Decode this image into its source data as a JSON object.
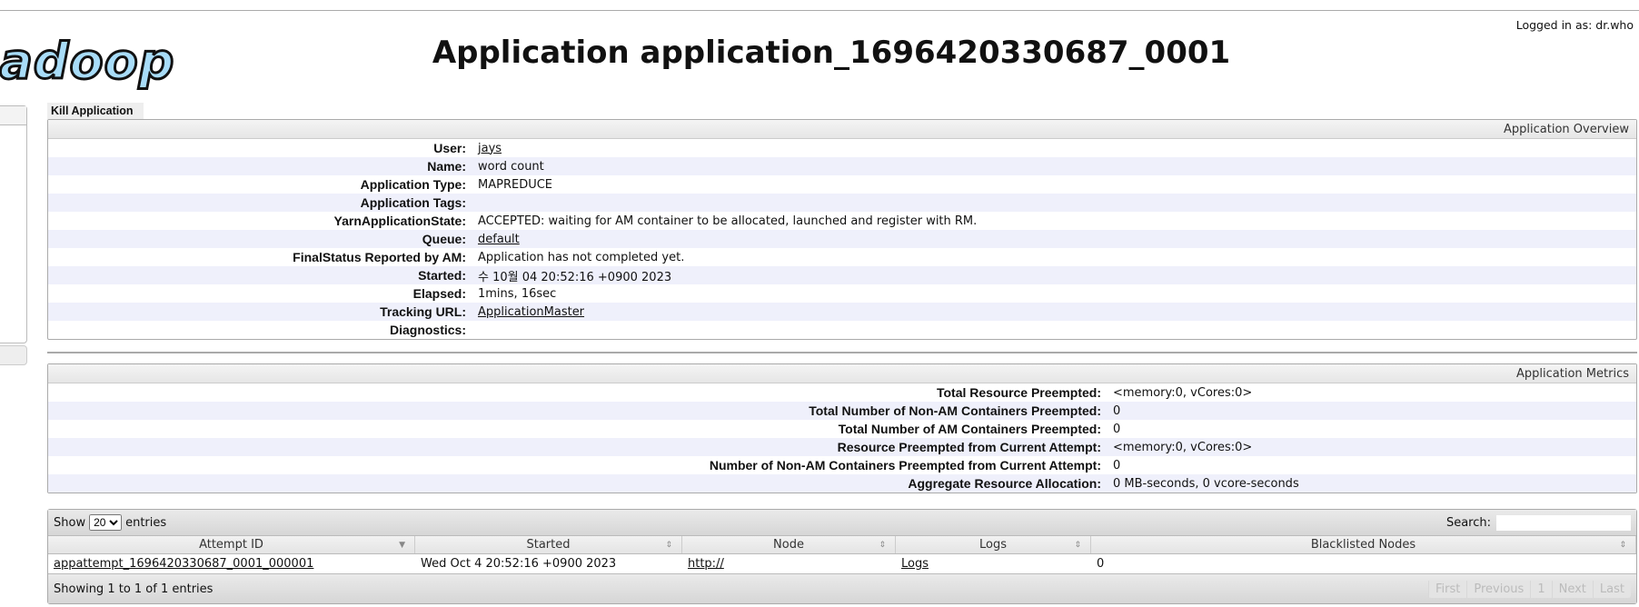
{
  "header": {
    "logo": "hadoop",
    "title": "Application application_1696420330687_0001",
    "logged_in": "Logged in as: dr.who"
  },
  "actions": {
    "kill": "Kill Application"
  },
  "overview": {
    "title": "Application Overview",
    "rows": [
      {
        "label": "User:",
        "value": "jays",
        "link": true
      },
      {
        "label": "Name:",
        "value": "word count"
      },
      {
        "label": "Application Type:",
        "value": "MAPREDUCE"
      },
      {
        "label": "Application Tags:",
        "value": ""
      },
      {
        "label": "YarnApplicationState:",
        "value": "ACCEPTED: waiting for AM container to be allocated, launched and register with RM."
      },
      {
        "label": "Queue:",
        "value": "default",
        "link": true
      },
      {
        "label": "FinalStatus Reported by AM:",
        "value": "Application has not completed yet."
      },
      {
        "label": "Started:",
        "value": "수 10월 04 20:52:16 +0900 2023"
      },
      {
        "label": "Elapsed:",
        "value": "1mins, 16sec"
      },
      {
        "label": "Tracking URL:",
        "value": "ApplicationMaster",
        "link": true
      },
      {
        "label": "Diagnostics:",
        "value": ""
      }
    ]
  },
  "metrics": {
    "title": "Application Metrics",
    "rows": [
      {
        "label": "Total Resource Preempted:",
        "value": "<memory:0, vCores:0>"
      },
      {
        "label": "Total Number of Non-AM Containers Preempted:",
        "value": "0"
      },
      {
        "label": "Total Number of AM Containers Preempted:",
        "value": "0"
      },
      {
        "label": "Resource Preempted from Current Attempt:",
        "value": "<memory:0, vCores:0>"
      },
      {
        "label": "Number of Non-AM Containers Preempted from Current Attempt:",
        "value": "0"
      },
      {
        "label": "Aggregate Resource Allocation:",
        "value": "0 MB-seconds, 0 vcore-seconds"
      }
    ]
  },
  "table": {
    "show": "Show",
    "entries": "entries",
    "page_size": "20",
    "search_label": "Search:",
    "search_value": "",
    "columns": [
      "Attempt ID",
      "Started",
      "Node",
      "Logs",
      "Blacklisted Nodes"
    ],
    "rows": [
      [
        "appattempt_1696420330687_0001_000001",
        "Wed Oct 4 20:52:16 +0900 2023",
        "http://",
        "Logs",
        "0"
      ]
    ],
    "info": "Showing 1 to 1 of 1 entries",
    "pager": [
      "First",
      "Previous",
      "1",
      "Next",
      "Last"
    ]
  }
}
